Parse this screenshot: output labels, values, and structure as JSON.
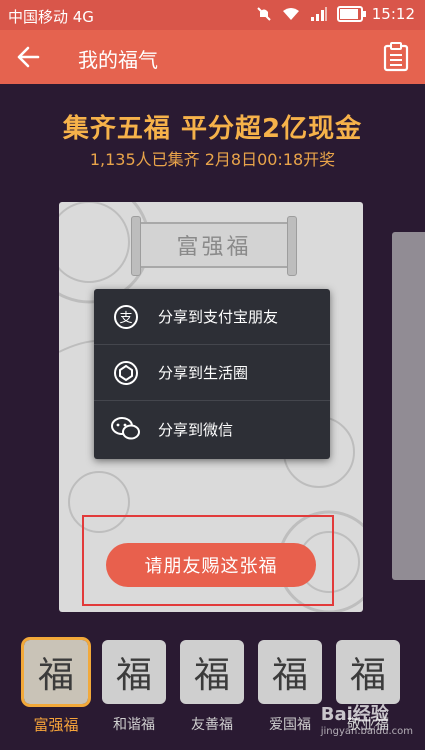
{
  "status": {
    "carrier": "中国移动 4G",
    "time": "15:12"
  },
  "header": {
    "title": "我的福气",
    "back_icon": "back-arrow-icon",
    "menu_icon": "clipboard-list-icon"
  },
  "banner": {
    "headline": "集齐五福 平分超2亿现金",
    "subline": "1,135人已集齐 2月8日00:18开奖"
  },
  "card": {
    "name": "富强福"
  },
  "share_menu": [
    {
      "label": "分享到支付宝朋友",
      "icon": "alipay-icon"
    },
    {
      "label": "分享到生活圈",
      "icon": "life-circle-icon"
    },
    {
      "label": "分享到微信",
      "icon": "wechat-icon"
    }
  ],
  "claim_button": "请朋友赐这张福",
  "fu_cards": [
    {
      "glyph": "福",
      "label": "富强福",
      "selected": true
    },
    {
      "glyph": "福",
      "label": "和谐福",
      "selected": false
    },
    {
      "glyph": "福",
      "label": "友善福",
      "selected": false
    },
    {
      "glyph": "福",
      "label": "爱国福",
      "selected": false
    },
    {
      "glyph": "福",
      "label": "敬业福",
      "selected": false
    }
  ],
  "watermark": {
    "main": "Bai经验",
    "sub": "jingyan.baidu.com"
  },
  "colors": {
    "header": "#e5634f",
    "background": "#2a1a32",
    "accent": "#f6b24a",
    "button": "#e8604d"
  }
}
